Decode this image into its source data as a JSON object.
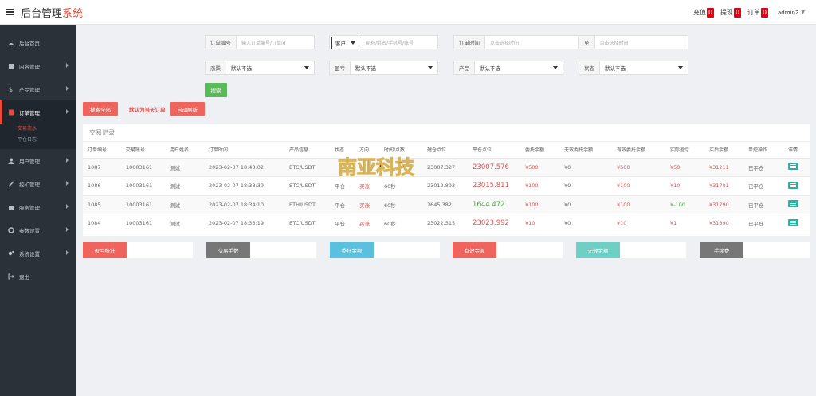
{
  "header": {
    "title": "后台管理",
    "title_sub": "系统",
    "links": [
      {
        "label": "充值",
        "badge": "0"
      },
      {
        "label": "提现",
        "badge": "0"
      },
      {
        "label": "订单",
        "badge": "0"
      }
    ],
    "user": "admin2"
  },
  "sidebar": {
    "items": [
      {
        "label": "后台首页",
        "icon": "dashboard-icon"
      },
      {
        "label": "内容管理",
        "icon": "document-icon"
      },
      {
        "label": "产品管理",
        "icon": "product-icon"
      },
      {
        "label": "订单管理",
        "icon": "order-icon"
      },
      {
        "label": "用户管理",
        "icon": "user-icon"
      },
      {
        "label": "挖矿管理",
        "icon": "mining-icon"
      },
      {
        "label": "服务管理",
        "icon": "service-icon"
      },
      {
        "label": "参数设置",
        "icon": "settings-icon"
      },
      {
        "label": "系统设置",
        "icon": "gears-icon"
      },
      {
        "label": "退出",
        "icon": "logout-icon"
      }
    ],
    "subitems": [
      {
        "label": "交易流水"
      },
      {
        "label": "平仓日志"
      }
    ]
  },
  "filters": {
    "order_no": {
      "label": "订单编号",
      "placeholder": "输入订单编号/订单id"
    },
    "customer": {
      "select": "客户",
      "placeholder": "昵称/姓名/手机号/账号"
    },
    "order_time": {
      "label": "订单时间",
      "placeholder": "点击选择时间"
    },
    "to": {
      "label": "至",
      "placeholder": "点击选择时间"
    },
    "direction": {
      "label": "涨跌",
      "value": "默认不选"
    },
    "win": {
      "label": "盈亏",
      "value": "默认不选"
    },
    "product": {
      "label": "产品",
      "value": "默认不选"
    },
    "status": {
      "label": "状态",
      "value": "默认不选"
    },
    "search_btn": "搜索",
    "search_all_btn": "搜索全部",
    "default_hint": "默认为当天订单",
    "auto_refresh_btn": "自动刷新"
  },
  "table": {
    "title": "交易记录",
    "headers": [
      "订单编号",
      "交易账号",
      "用户姓名",
      "订单时间",
      "产品信息",
      "状态",
      "方向",
      "时间/点数",
      "建仓点位",
      "平仓点位",
      "委托余额",
      "无效委托余额",
      "有效委托余额",
      "实际盈亏",
      "买后余额",
      "单控操作",
      "详情"
    ],
    "rows": [
      {
        "id": "1087",
        "account": "10003161",
        "name": "测试",
        "time": "2023-02-07 18:43:02",
        "product": "BTC/USDT",
        "status": "",
        "direction": "",
        "period": "",
        "open": "23007.327",
        "close": "23007.576",
        "close_color": "red",
        "amount": "¥500",
        "invalid": "¥0",
        "valid": "¥500",
        "profit": "¥50",
        "profit_color": "red",
        "balance": "¥31211",
        "op": "已平仓"
      },
      {
        "id": "1086",
        "account": "10003161",
        "name": "测试",
        "time": "2023-02-07 18:38:39",
        "product": "BTC/USDT",
        "status": "平仓",
        "direction": "买涨",
        "period": "60秒",
        "open": "23012.893",
        "close": "23015.811",
        "close_color": "red",
        "amount": "¥100",
        "invalid": "¥0",
        "valid": "¥100",
        "profit": "¥10",
        "profit_color": "red",
        "balance": "¥31701",
        "op": "已平仓"
      },
      {
        "id": "1085",
        "account": "10003161",
        "name": "测试",
        "time": "2023-02-07 18:34:10",
        "product": "ETH/USDT",
        "status": "平仓",
        "direction": "买涨",
        "period": "60秒",
        "open": "1645.382",
        "close": "1644.472",
        "close_color": "green",
        "amount": "¥100",
        "invalid": "¥0",
        "valid": "¥100",
        "profit": "¥-100",
        "profit_color": "green",
        "balance": "¥31790",
        "op": "已平仓"
      },
      {
        "id": "1084",
        "account": "10003161",
        "name": "测试",
        "time": "2023-02-07 18:33:19",
        "product": "BTC/USDT",
        "status": "平仓",
        "direction": "买涨",
        "period": "60秒",
        "open": "23022.515",
        "close": "23023.992",
        "close_color": "red",
        "amount": "¥10",
        "invalid": "¥0",
        "valid": "¥10",
        "profit": "¥1",
        "profit_color": "red",
        "balance": "¥31890",
        "op": "已平仓"
      }
    ]
  },
  "stats": [
    {
      "label": "盈亏统计",
      "color": "#f0645e"
    },
    {
      "label": "交易手数",
      "color": "#777777"
    },
    {
      "label": "委托金额",
      "color": "#5bc0de"
    },
    {
      "label": "有效金额",
      "color": "#f0645e"
    },
    {
      "label": "无效金额",
      "color": "#6fcfc4"
    },
    {
      "label": "手续费",
      "color": "#777777"
    }
  ],
  "watermark": {
    "text": "南亚科技"
  },
  "colors": {
    "accent": "#e64a3b",
    "sidebar": "#2b3139",
    "green": "#5cb85c",
    "red": "#f0645e"
  }
}
